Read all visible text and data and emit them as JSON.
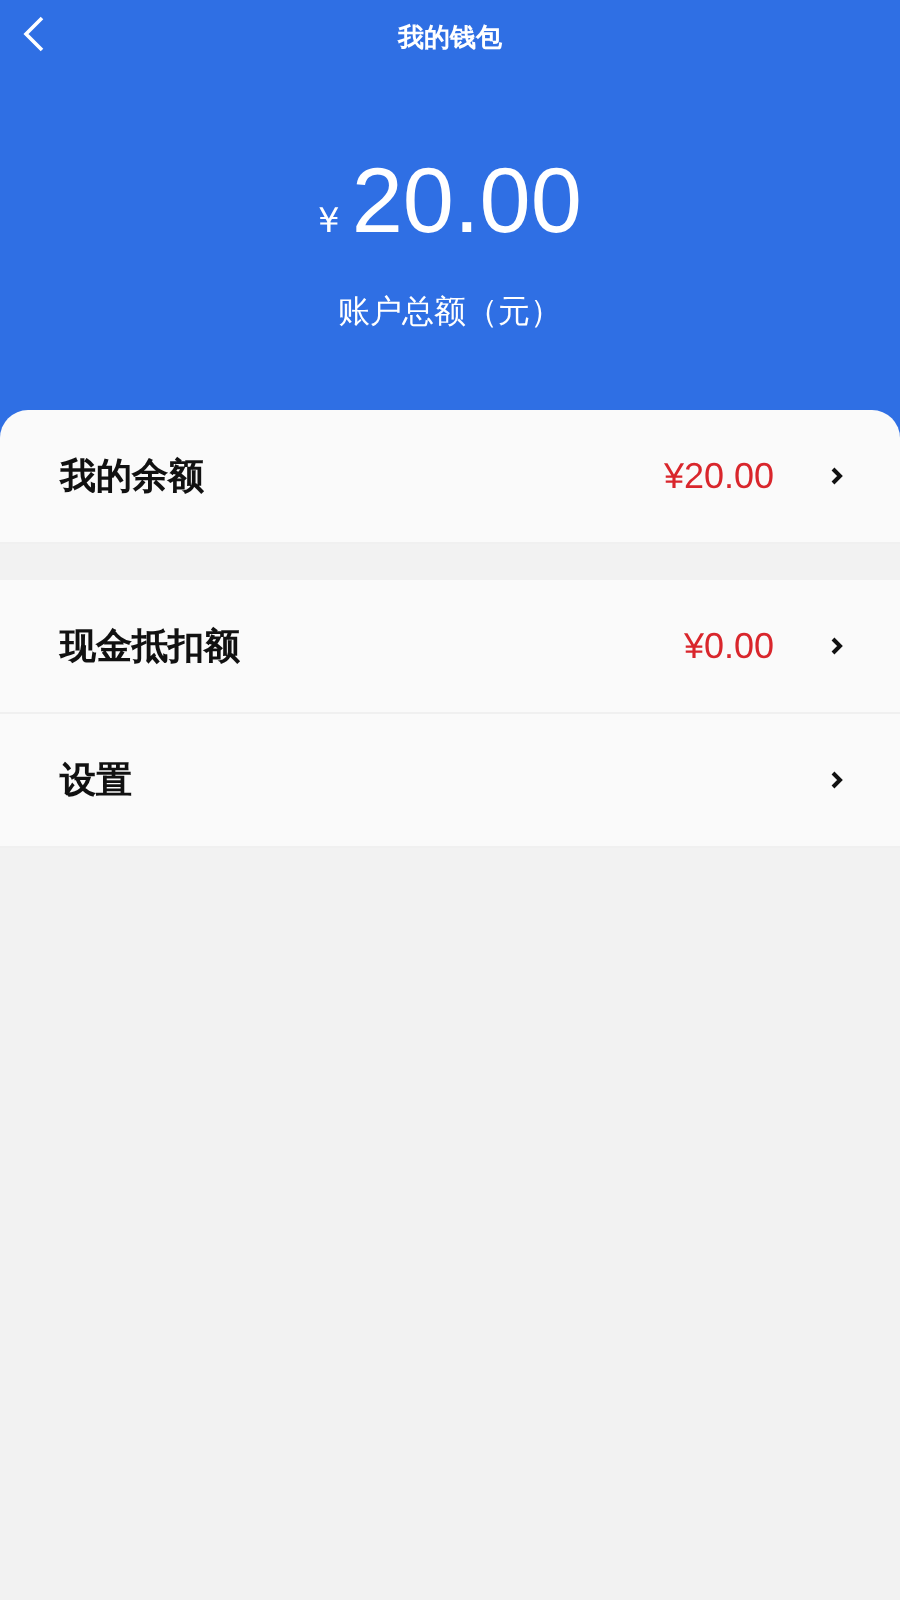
{
  "header": {
    "title": "我的钱包"
  },
  "balance": {
    "currency": "¥",
    "amount": "20.00",
    "label": "账户总额（元）"
  },
  "groups": [
    {
      "items": [
        {
          "label": "我的余额",
          "value": "¥20.00"
        }
      ]
    },
    {
      "items": [
        {
          "label": "现金抵扣额",
          "value": "¥0.00"
        },
        {
          "label": "设置"
        }
      ]
    }
  ]
}
